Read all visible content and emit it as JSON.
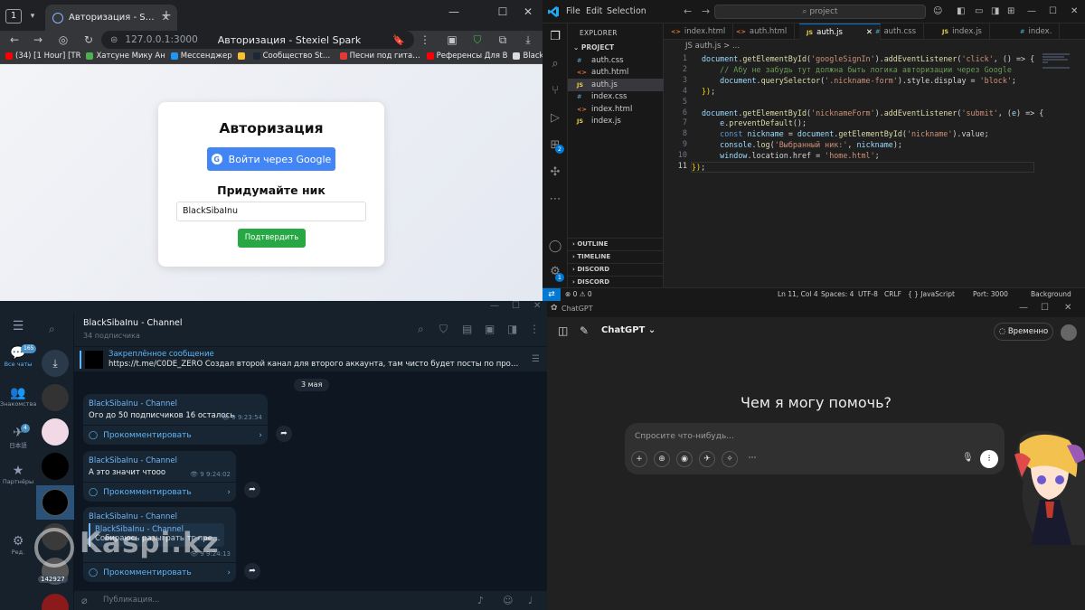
{
  "browser": {
    "workspace_label": "1",
    "tab_title": "Авторизация - Stexiel S",
    "window_controls": [
      "—",
      "☐",
      "✕"
    ],
    "url": "127.0.0.1:3000",
    "page_title": "Авторизация - Stexiel Spark",
    "bookmarks": [
      {
        "label": "(34) [1 Hour] [TR",
        "color": "#ff0000"
      },
      {
        "label": "Хатсуне Мику Ан",
        "color": "#4caf50"
      },
      {
        "label": "Мессенджер",
        "color": "#2196f3"
      },
      {
        "label": "",
        "color": "#fbc02d"
      },
      {
        "label": "Сообщество Steam",
        "color": "#1b2838"
      },
      {
        "label": "Песни под гитару",
        "color": "#e53935"
      },
      {
        "label": "Референсы Для В",
        "color": "#ff0000"
      },
      {
        "label": "BlackS",
        "color": "#dddddd"
      }
    ],
    "page": {
      "heading": "Авторизация",
      "google_button": "Войти через Google",
      "subheading": "Придумайте ник",
      "nickname_value": "BlackSibaInu",
      "confirm_button": "Подтвердить"
    }
  },
  "vscode": {
    "menu": [
      "File",
      "Edit",
      "Selection"
    ],
    "search": "project",
    "explorer_title": "EXPLORER",
    "project": "PROJECT",
    "files": [
      {
        "name": "auth.css",
        "type": "css"
      },
      {
        "name": "auth.html",
        "type": "html"
      },
      {
        "name": "auth.js",
        "type": "js",
        "selected": true
      },
      {
        "name": "index.css",
        "type": "css"
      },
      {
        "name": "index.html",
        "type": "html"
      },
      {
        "name": "index.js",
        "type": "js"
      }
    ],
    "sections": [
      "OUTLINE",
      "TIMELINE",
      "DISCORD",
      "DISCORD"
    ],
    "tabs": [
      {
        "name": "index.html",
        "type": "html"
      },
      {
        "name": "auth.html",
        "type": "html"
      },
      {
        "name": "auth.js",
        "type": "js",
        "active": true
      },
      {
        "name": "auth.css",
        "type": "css"
      },
      {
        "name": "index.js",
        "type": "js"
      },
      {
        "name": "index.",
        "type": "css"
      }
    ],
    "breadcrumb": "JS auth.js > ...",
    "code_lines": [
      "document.getElementById('googleSignIn').addEventListener('click', () => {",
      "    // Абу не забудь тут должна быть логика авторизации через Google",
      "    document.querySelector('.nickname-form').style.display = 'block';",
      "});",
      "",
      "document.getElementById('nicknameForm').addEventListener('submit', (e) => {",
      "    e.preventDefault();",
      "    const nickname = document.getElementById('nickname').value;",
      "    console.log('Выбранный ник:', nickname);",
      "    window.location.href = 'home.html';",
      "});"
    ],
    "current_line": 11,
    "status": {
      "problems": "⊗ 0 ⚠ 0",
      "position": "Ln 11, Col 4",
      "spaces": "Spaces: 4",
      "encoding": "UTF-8",
      "eol": "CRLF",
      "language": "{ } JavaScript",
      "port": "Port: 3000",
      "background": "Background"
    },
    "badges": {
      "extensions": "2",
      "account": "1"
    }
  },
  "telegram": {
    "channel_title": "BlackSibaInu - Channel",
    "subscribers": "34 подписчика",
    "sidebar": [
      {
        "label": "Все чаты",
        "badge": "165",
        "icon": "💬"
      },
      {
        "label": "Знакомства",
        "badge": "",
        "icon": "👥"
      },
      {
        "label": "日本語",
        "badge": "4",
        "icon": "✈"
      },
      {
        "label": "Партнёры",
        "badge": "",
        "icon": "★"
      },
      {
        "label": "Ред.",
        "badge": "",
        "icon": "⚙"
      }
    ],
    "chat_badge": "142927",
    "pinned_title": "Закреплённое сообщение",
    "pinned_text": "https://t.me/C0DE_ZERO  Создал второй канал для второго аккаунта, там чисто будет посты по программировани...",
    "date": "3 мая",
    "messages": [
      {
        "author": "BlackSibaInu - Channel",
        "text": "Ого до 50 подписчиков 16 осталось",
        "views": "9",
        "time": "9:23:54",
        "comment": "Прокомментировать"
      },
      {
        "author": "BlackSibaInu - Channel",
        "text": "А это значит чтооо",
        "views": "9",
        "time": "9:24:02",
        "comment": "Прокомментировать"
      },
      {
        "author": "BlackSibaInu - Channel",
        "quote_author": "BlackSibaInu - Channel",
        "quote_text": "Собираюсь разыграть тг преми...",
        "views": "9",
        "time": "9:24:13",
        "comment": "Прокомментировать"
      }
    ],
    "watermark": "Kaspi.kz",
    "compose_placeholder": "Публикация..."
  },
  "chatgpt": {
    "window_title": "ChatGPT",
    "model": "ChatGPT",
    "temporary": "Временно",
    "heading": "Чем я могу помочь?",
    "placeholder": "Спросите что-нибудь..."
  }
}
